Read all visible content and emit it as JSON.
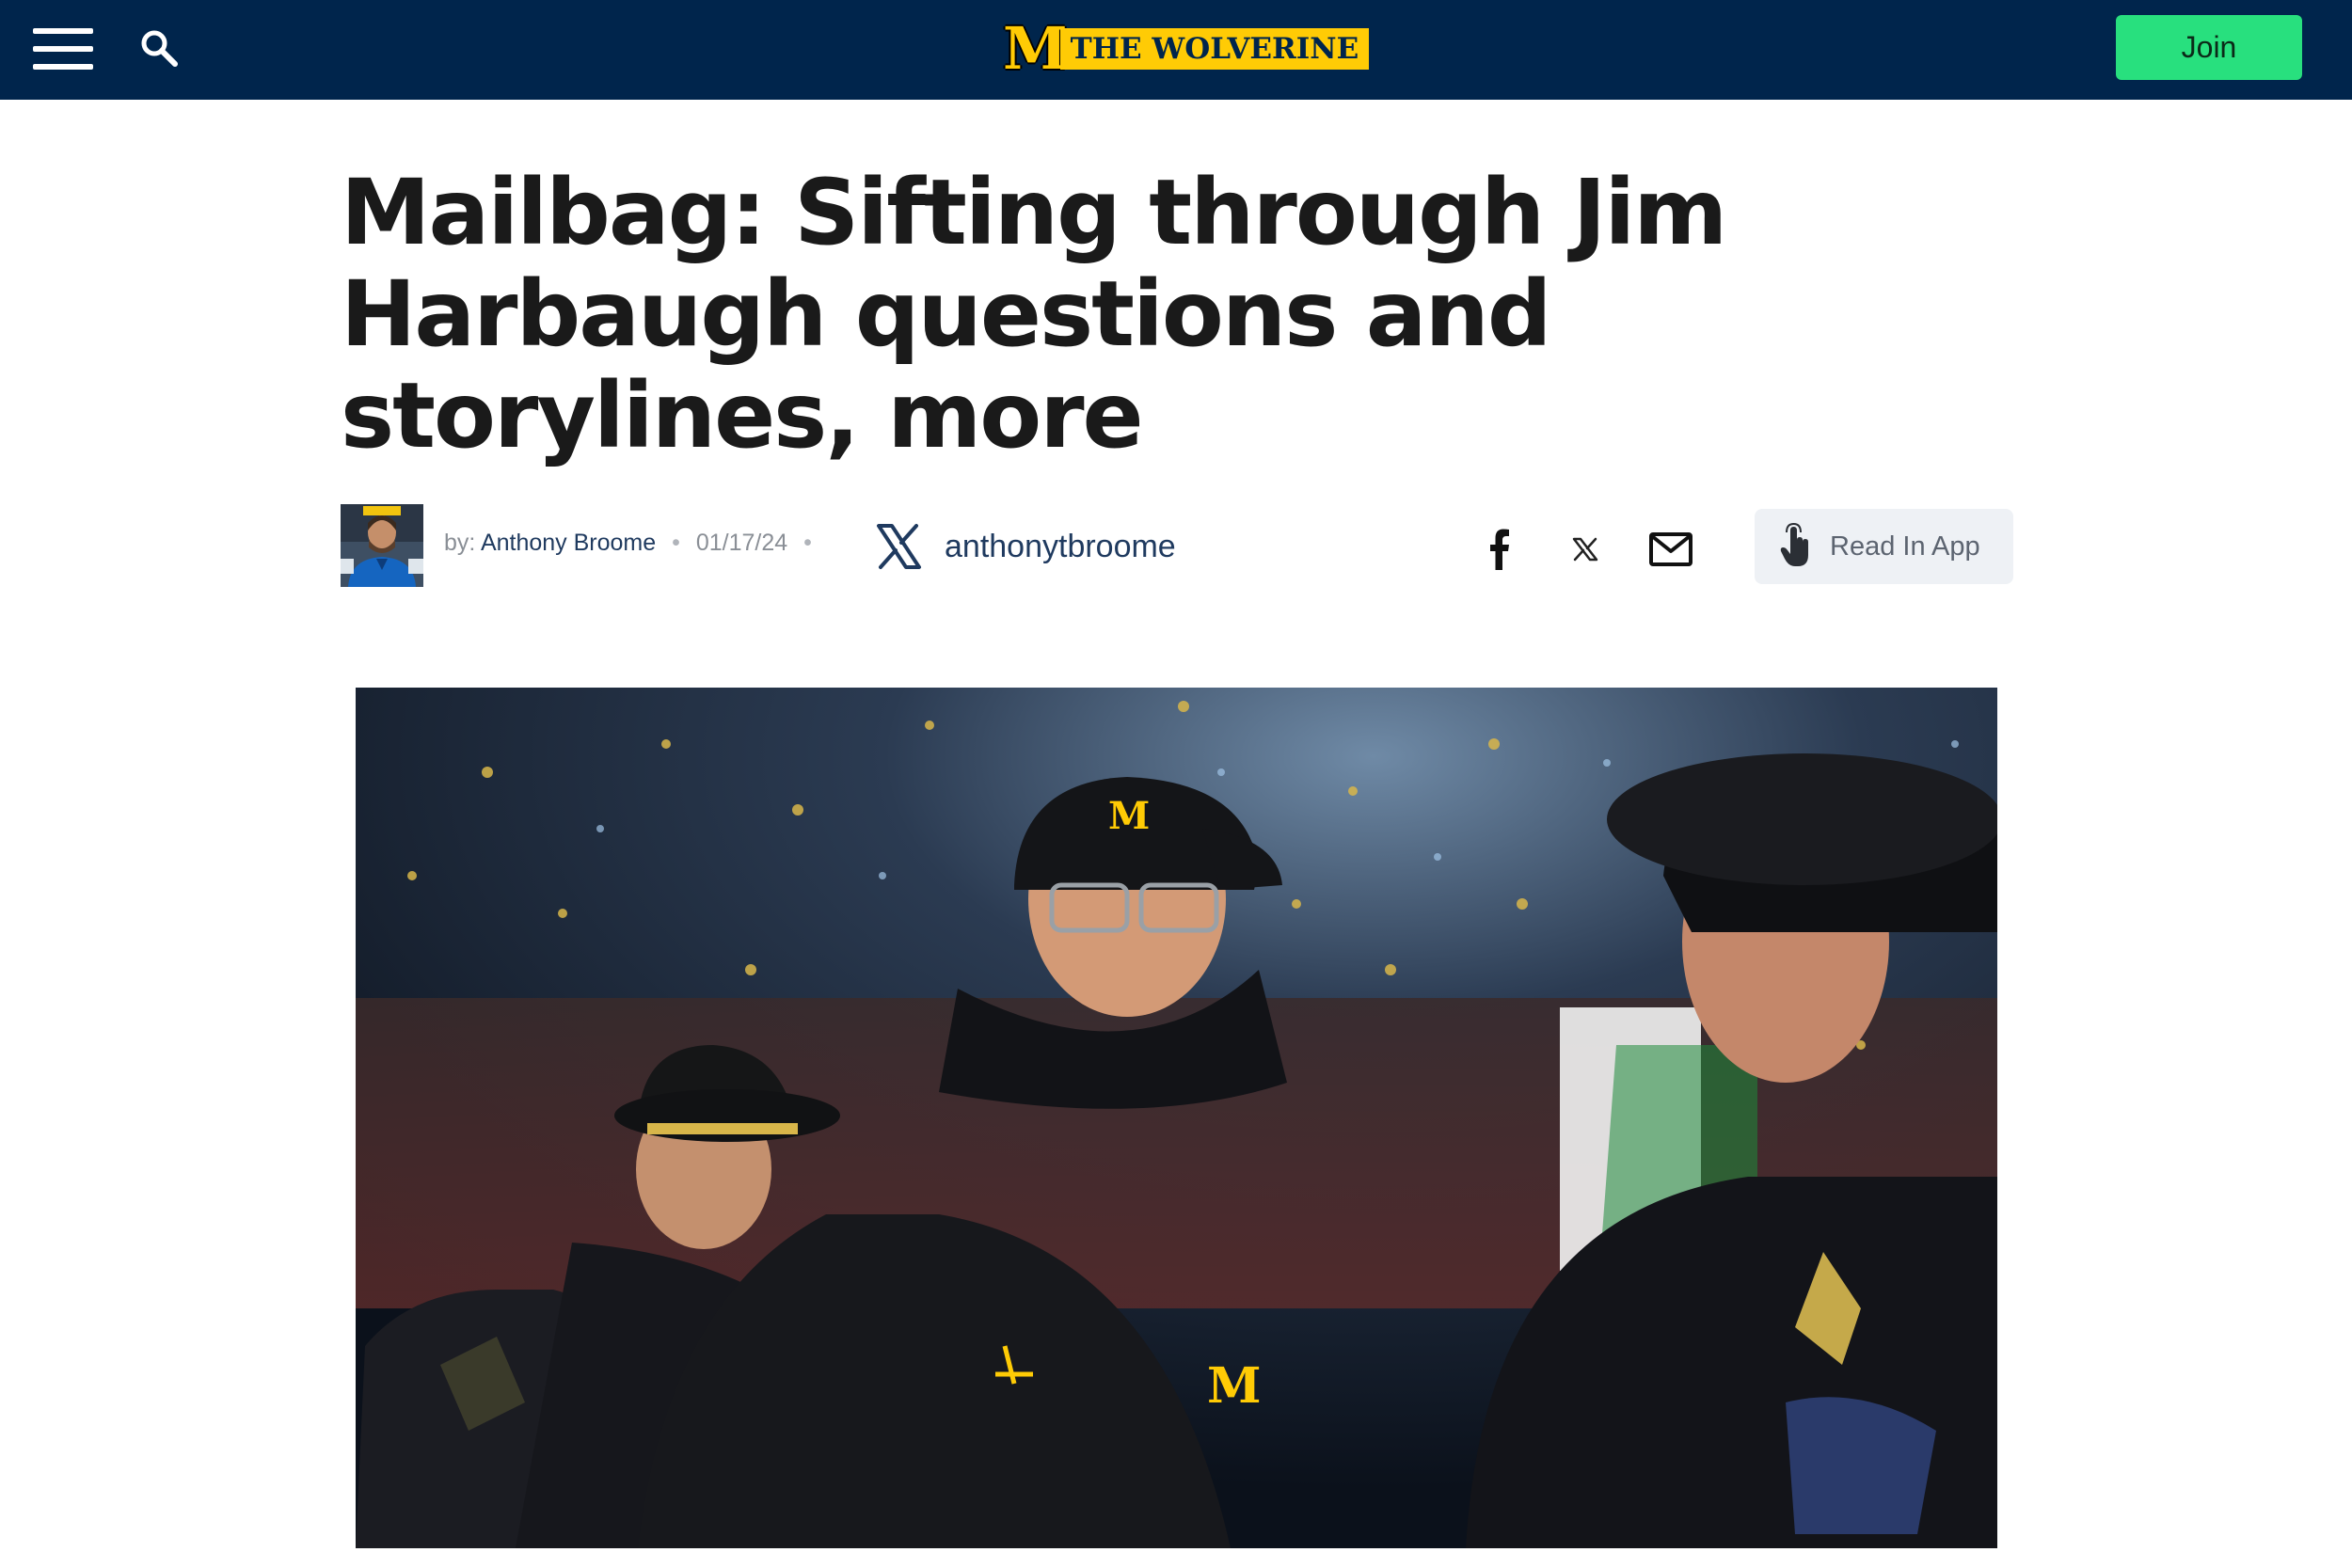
{
  "header": {
    "logo": {
      "mark": "M",
      "wordmark": "THE WOLVERINE"
    },
    "join_label": "Join",
    "colors": {
      "bar": "#00254c",
      "join": "#28e07e",
      "maize": "#ffcb05"
    }
  },
  "article": {
    "headline": "Mailbag: Sifting through Jim Harbaugh questions and storylines, more",
    "byline": {
      "prefix": "by:",
      "author": "Anthony Broome",
      "date": "01/17/24",
      "x_handle": "anthonytbroome"
    },
    "share": [
      "facebook-icon",
      "x-icon",
      "email-icon"
    ],
    "read_in_app_label": "Read In App"
  }
}
